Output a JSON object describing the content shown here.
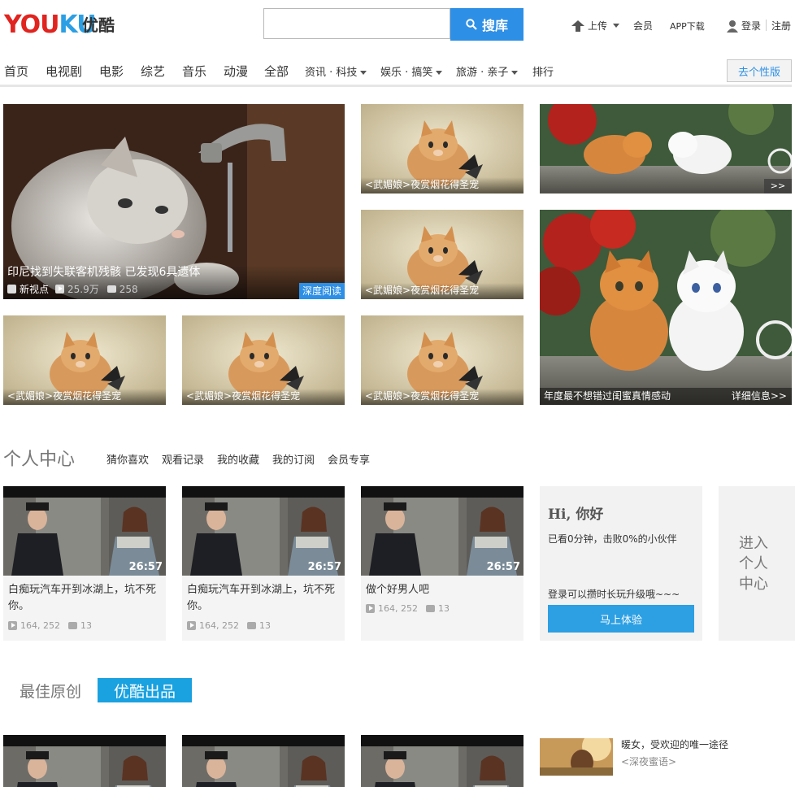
{
  "header": {
    "logo_en": "YOUKU",
    "logo_cn": "优酷",
    "search_button": "搜库",
    "upload": "上传",
    "vip": "会员",
    "app_download": "APP下载",
    "login": "登录",
    "register": "注册"
  },
  "nav": {
    "items": [
      "首页",
      "电视剧",
      "电影",
      "综艺",
      "音乐",
      "动漫",
      "全部"
    ],
    "dropdowns": [
      "资讯 · 科技",
      "娱乐 · 搞笑",
      "旅游 · 亲子"
    ],
    "rank": "排行",
    "personal_version": "去个性版"
  },
  "hero": {
    "main_caption": "印尼找到失联客机残骸 已发现6具遗体",
    "main_source": "新视点",
    "main_views": "25.9万",
    "main_comments": "258",
    "main_badge": "深度阅读",
    "small_caption": "<武媚娘>夜赏烟花得圣宠",
    "right_bottom_caption": "年度最不想错过闺蜜真情感动",
    "right_bottom_more": "详细信息>>",
    "right_top_arrows": ">>"
  },
  "personal": {
    "title": "个人中心",
    "tabs": [
      "猜你喜欢",
      "观看记录",
      "我的收藏",
      "我的订阅",
      "会员专享"
    ],
    "cards": [
      {
        "duration": "26:57",
        "title": "白痴玩汽车开到冰湖上，坑不死你。",
        "views": "164, 252",
        "comments": "13"
      },
      {
        "duration": "26:57",
        "title": "白痴玩汽车开到冰湖上，坑不死你。",
        "views": "164, 252",
        "comments": "13"
      },
      {
        "duration": "26:57",
        "title": "做个好男人吧",
        "views": "164, 252",
        "comments": "13"
      }
    ],
    "hi_title": "Hi, 你好",
    "hi_line1": "已看0分钟，击败0%的小伙伴",
    "hi_line2": "登录可以攒时长玩升级哦~~~",
    "hi_button": "马上体验",
    "enter_line1": "进入",
    "enter_line2": "个人",
    "enter_line3": "中心"
  },
  "bottom": {
    "tab_original": "最佳原创",
    "tab_youku": "优酷出品",
    "side_title": "暖女，受欢迎的唯一途径",
    "side_sub": "<深夜蜜语>"
  },
  "colors": {
    "accent_blue": "#2d8fe6",
    "logo_red": "#e0241f",
    "logo_blue": "#2b9fe4"
  }
}
